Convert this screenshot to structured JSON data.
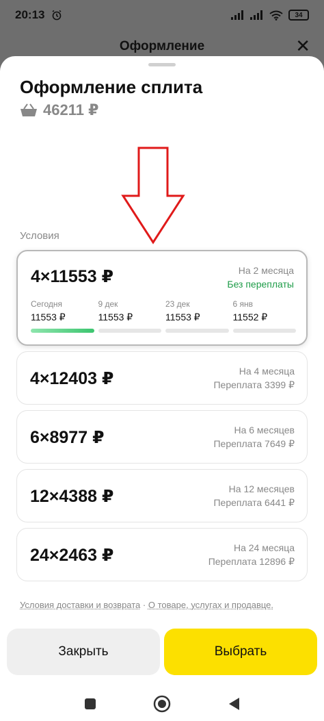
{
  "status_bar": {
    "time": "20:13",
    "battery": "34"
  },
  "background": {
    "header_title": "Оформление"
  },
  "sheet": {
    "title": "Оформление сплита",
    "total_price": "46211 ₽",
    "section_label": "Условия",
    "plans": [
      {
        "amount": "4×11553 ₽",
        "period": "На 2 месяца",
        "overpay": "Без переплаты",
        "selected": true,
        "schedule": [
          {
            "date": "Сегодня",
            "amount": "11553 ₽",
            "paid": true
          },
          {
            "date": "9 дек",
            "amount": "11553 ₽",
            "paid": false
          },
          {
            "date": "23 дек",
            "amount": "11553 ₽",
            "paid": false
          },
          {
            "date": "6 янв",
            "amount": "11552 ₽",
            "paid": false
          }
        ]
      },
      {
        "amount": "4×12403 ₽",
        "period": "На 4 месяца",
        "overpay": "Переплата 3399 ₽",
        "selected": false
      },
      {
        "amount": "6×8977 ₽",
        "period": "На 6 месяцев",
        "overpay": "Переплата 7649 ₽",
        "selected": false
      },
      {
        "amount": "12×4388 ₽",
        "period": "На 12 месяцев",
        "overpay": "Переплата 6441 ₽",
        "selected": false
      },
      {
        "amount": "24×2463 ₽",
        "period": "На 24 месяца",
        "overpay": "Переплата 12896 ₽",
        "selected": false
      }
    ],
    "links": {
      "delivery": "Условия доставки и возврата",
      "separator": "·",
      "about": "О товаре, услугах и продавце."
    },
    "buttons": {
      "close_label": "Закрыть",
      "select_label": "Выбрать"
    }
  },
  "colors": {
    "accent_yellow": "#fce000",
    "green": "#1e9c48",
    "annotation_red": "#e01a1a"
  }
}
